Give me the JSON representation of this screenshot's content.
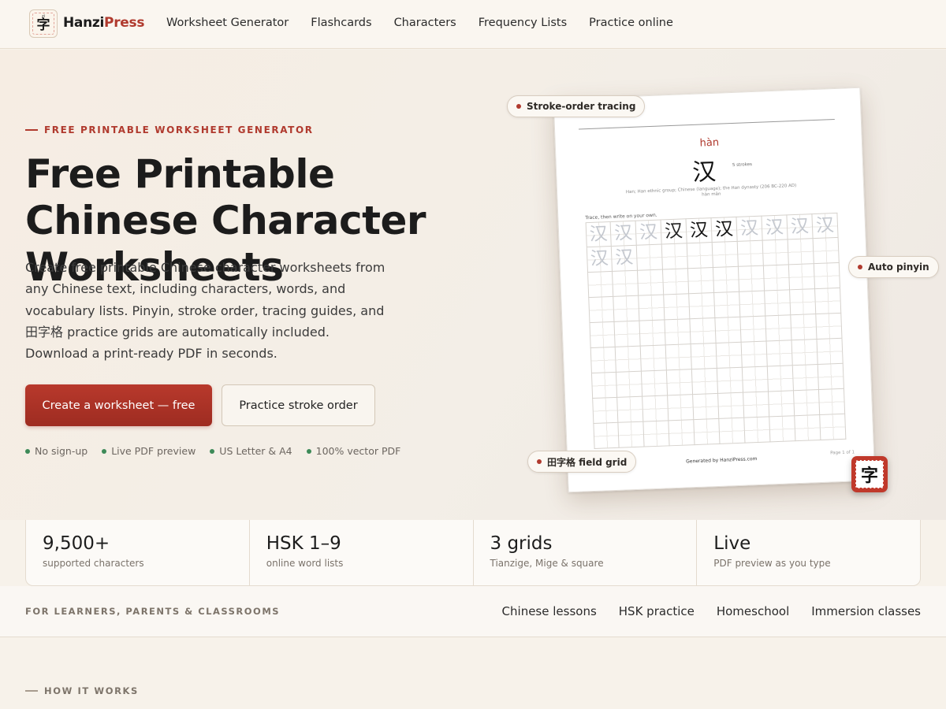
{
  "nav": {
    "logo_pinyin": "zì",
    "logo_char": "字",
    "brand_part1": "Hanzi",
    "brand_part2": "Press",
    "links": [
      "Worksheet Generator",
      "Flashcards",
      "Characters",
      "Frequency Lists",
      "Practice online"
    ]
  },
  "hero": {
    "eyebrow": "FREE PRINTABLE WORKSHEET GENERATOR",
    "title": "Free Printable Chinese Character Worksheets",
    "lede": "Create free printable Chinese character worksheets from any Chinese text, including characters, words, and vocabulary lists. Pinyin, stroke order, tracing guides, and 田字格 practice grids are automatically included. Download a print-ready PDF in seconds.",
    "primary_button": "Create a worksheet — free",
    "secondary_button": "Practice stroke order",
    "checks": [
      "No sign-up",
      "Live PDF preview",
      "US Letter & A4",
      "100% vector PDF"
    ]
  },
  "preview": {
    "pinyin": "hàn",
    "character": "汉",
    "strokes": "5 strokes",
    "definition_line1": "Han; Han ethnic group; Chinese (language); the Han dynasty (206 BC-220 AD)",
    "definition_line2": "hàn mǎn",
    "instruction": "Trace, then write on your own.",
    "footer": "Generated by HanziPress.com",
    "page": "Page 1 of 1",
    "pills": [
      "Stroke-order tracing",
      "Auto pinyin",
      "田字格 field grid"
    ],
    "badge_char": "字"
  },
  "stats": [
    {
      "value": "9,500+",
      "label": "supported characters"
    },
    {
      "value": "HSK 1–9",
      "label": "online word lists"
    },
    {
      "value": "3 grids",
      "label": "Tianzige, Mige & square"
    },
    {
      "value": "Live",
      "label": "PDF preview as you type"
    }
  ],
  "audience": {
    "label": "FOR LEARNERS, PARENTS & CLASSROOMS",
    "links": [
      "Chinese lessons",
      "HSK practice",
      "Homeschool",
      "Immersion classes"
    ]
  },
  "how_it_works": "HOW IT WORKS",
  "colors": {
    "accent": "#b03a2e",
    "check_dot": "#3d8a58",
    "background": "#f7f2ea"
  }
}
